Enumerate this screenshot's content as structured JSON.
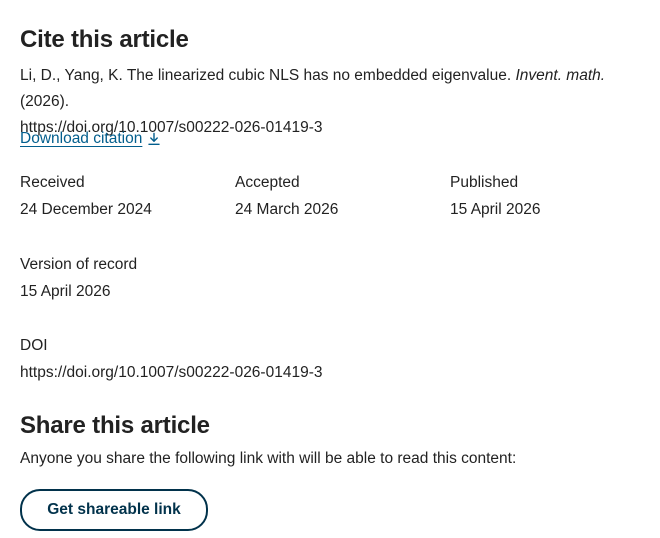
{
  "cite_section": {
    "title": "Cite this article",
    "citation": {
      "authors_title": "Li, D., Yang, K. The linearized cubic NLS has no embedded eigenvalue. ",
      "journal": "Invent. math.",
      "year": " (2026).",
      "doi_url": "https://doi.org/10.1007/s00222-026-01419-3"
    },
    "download_label": "Download citation",
    "download_icon": "download-icon"
  },
  "dates": {
    "received_label": "Received",
    "received_value": "24 December 2024",
    "accepted_label": "Accepted",
    "accepted_value": "24 March 2026",
    "published_label": "Published",
    "published_value": "15 April 2026",
    "version_label": "Version of record",
    "version_value": "15 April 2026",
    "doi_label": "DOI",
    "doi_value": "https://doi.org/10.1007/s00222-026-01419-3"
  },
  "share_section": {
    "title": "Share this article",
    "description": "Anyone you share the following link with will be able to read this content:",
    "button_label": "Get shareable link"
  },
  "colors": {
    "link": "#025e8d",
    "button_border": "#01324b",
    "text": "#222222"
  }
}
